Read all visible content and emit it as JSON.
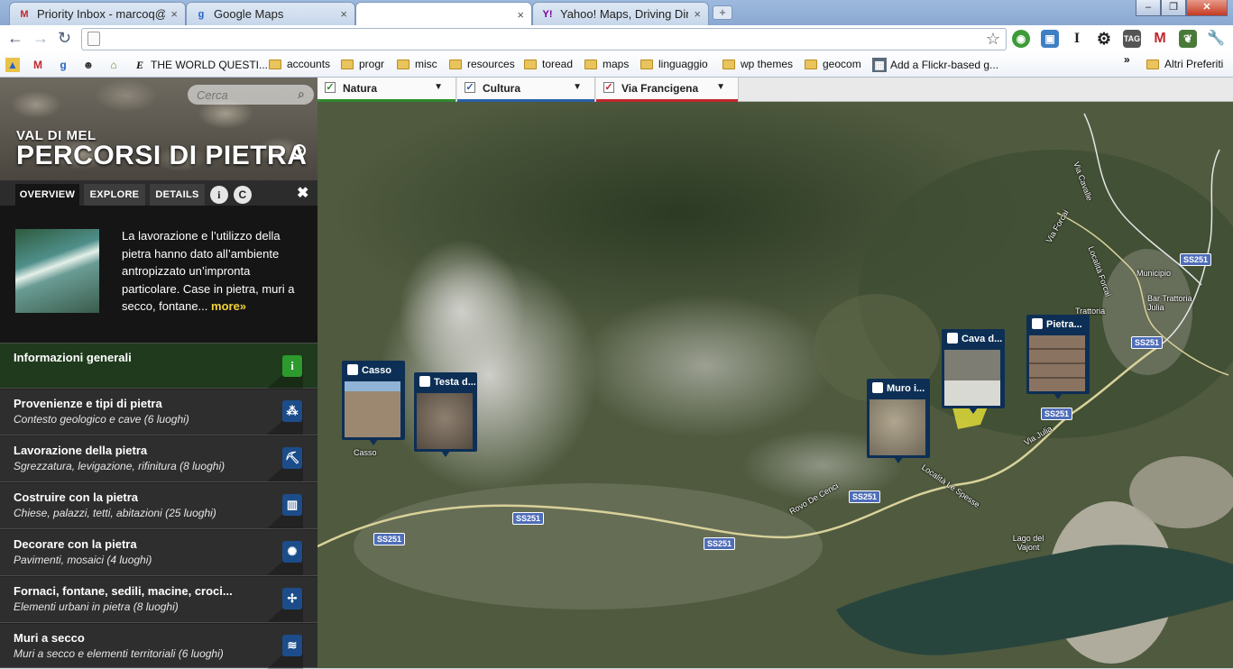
{
  "browser": {
    "tabs": [
      {
        "title": "Priority Inbox - marcoq@...",
        "icon": "gmail-icon"
      },
      {
        "title": "Google Maps",
        "icon": "google-maps-icon"
      },
      {
        "title": "",
        "icon": ""
      },
      {
        "title": "Yahoo! Maps, Driving Dir...",
        "icon": "yahoo-icon"
      }
    ],
    "address_value": "",
    "bookmarks": [
      {
        "label": "THE WORLD QUESTI...",
        "type": "site"
      },
      {
        "label": "accounts",
        "type": "folder"
      },
      {
        "label": "progr",
        "type": "folder"
      },
      {
        "label": "misc",
        "type": "folder"
      },
      {
        "label": "resources",
        "type": "folder"
      },
      {
        "label": "toread",
        "type": "folder"
      },
      {
        "label": "maps",
        "type": "folder"
      },
      {
        "label": "linguaggio",
        "type": "folder"
      },
      {
        "label": "wp themes",
        "type": "folder"
      },
      {
        "label": "geocom",
        "type": "folder"
      },
      {
        "label": "Add a Flickr-based g...",
        "type": "site"
      },
      {
        "label": "Altri Preferiti",
        "type": "folder"
      }
    ],
    "overflow": "»"
  },
  "app": {
    "search_placeholder": "Cerca",
    "title_sub": "VAL DI MEL",
    "title_main": "PERCORSI DI PIETRA",
    "tabs": {
      "overview": "OVERVIEW",
      "explore": "EXPLORE",
      "details": "DETAILS",
      "info": "i",
      "credits": "C"
    },
    "overview_text": "La lavorazione e l’utilizzo della pietra hanno dato all’ambiente antropizzato un’impronta particolare. Case in pietra, muri a secco, fontane... ",
    "overview_more": "more»",
    "categories": [
      {
        "title": "Informazioni generali",
        "subtitle": "",
        "icon": "info-icon",
        "glyph": "i"
      },
      {
        "title": "Provenienze e tipi di pietra",
        "subtitle": "Contesto geologico e cave (6 luoghi)",
        "icon": "stones-icon",
        "glyph": "⁂"
      },
      {
        "title": "Lavorazione della pietra",
        "subtitle": "Sgrezzatura, levigazione, rifinitura (8 luoghi)",
        "icon": "pickaxe-icon",
        "glyph": "⛏"
      },
      {
        "title": "Costruire con la pietra",
        "subtitle": "Chiese, palazzi, tetti, abitazioni (25 luoghi)",
        "icon": "building-icon",
        "glyph": "▥"
      },
      {
        "title": "Decorare con la pietra",
        "subtitle": "Pavimenti, mosaici (4 luoghi)",
        "icon": "decoration-icon",
        "glyph": "✺"
      },
      {
        "title": "Fornaci, fontane, sedili, macine, croci...",
        "subtitle": "Elementi urbani in pietra (8 luoghi)",
        "icon": "cross-icon",
        "glyph": "✢"
      },
      {
        "title": "Muri a secco",
        "subtitle": "Muri a secco e elementi territoriali (6 luoghi)",
        "icon": "wall-icon",
        "glyph": "≋"
      }
    ],
    "layers": [
      {
        "label": "Natura",
        "checked": "✓",
        "color": "#2f8a2f"
      },
      {
        "label": "Cultura",
        "checked": "✓",
        "color": "#2a5fa8"
      },
      {
        "label": "Via Francigena",
        "checked": "✓",
        "color": "#c0272d"
      }
    ],
    "markers": [
      {
        "label": "Casso",
        "icon": "house-icon"
      },
      {
        "label": "Testa d...",
        "icon": "decoration-icon"
      },
      {
        "label": "Muro i...",
        "icon": "wall-icon"
      },
      {
        "label": "Cava d...",
        "icon": "stones-icon"
      },
      {
        "label": "Pietra...",
        "icon": "pickaxe-icon"
      }
    ],
    "map_labels": {
      "casso": "Casso",
      "municipio": "Municipio",
      "bar": "Bar Trattoria Julia",
      "trattoria": "Trattoria",
      "via_cavalle": "Via Cavalle",
      "via_forcai": "Via Forcai",
      "localita_forcai": "Località Forcai",
      "via_julia": "Via Julia",
      "localita_spesse": "Località Le Spesse",
      "rovo": "Rovo De Cenci",
      "lago": "Lago del Vajont"
    },
    "roads": [
      "SS251",
      "SS251",
      "SS251",
      "SS251",
      "SS251",
      "SS251"
    ]
  }
}
